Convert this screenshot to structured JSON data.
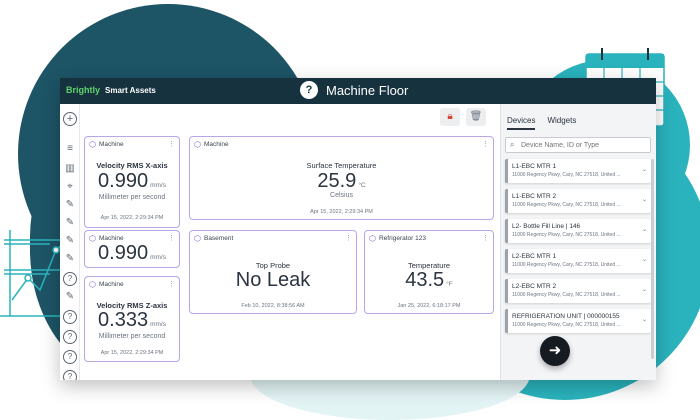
{
  "brand": {
    "logo": "Brightly",
    "product": "Smart Assets"
  },
  "page": {
    "title": "Machine Floor",
    "title_icon": "help-circle-icon"
  },
  "widgets": {
    "w1": {
      "source": "Machine",
      "title": "Velocity RMS X-axis",
      "value": "0.990",
      "unit": "mm/s",
      "subtitle": "Millimeter per second",
      "timestamp": "Apr 15, 2022, 2:29:34 PM"
    },
    "w2": {
      "source": "Machine",
      "title": "Surface Temperature",
      "value": "25.9",
      "unit": "°C",
      "subtitle": "Celsius",
      "timestamp": "Apr 15, 2022, 2:29:34 PM"
    },
    "w3": {
      "source": "Machine",
      "value": "0.990",
      "unit": "mm/s"
    },
    "w4": {
      "source": "Basement",
      "title": "Top Probe",
      "value": "No Leak",
      "timestamp": "Feb 10, 2022, 8:38:56 AM"
    },
    "w5": {
      "source": "Refrigerator 123",
      "title": "Temperature",
      "value": "43.5",
      "unit": "°F",
      "timestamp": "Jan 25, 2022, 6:18:17 PM"
    },
    "w6": {
      "source": "Machine",
      "title": "Velocity RMS Z-axis",
      "value": "0.333",
      "unit": "mm/s",
      "subtitle": "Millimeter per second",
      "timestamp": "Apr 15, 2022, 2:29:34 PM"
    }
  },
  "panel": {
    "tabs": [
      "Devices",
      "Widgets"
    ],
    "search_placeholder": "Device Name, ID or Type",
    "devices": [
      {
        "name": "L1-EBC MTR 1",
        "address": "11000 Regency Pkwy, Cary, NC 27518, United ..."
      },
      {
        "name": "L1-EBC MTR 2",
        "address": "11000 Regency Pkwy, Cary, NC 27518, United ..."
      },
      {
        "name": "L2- Bottle Fill Line | 146",
        "address": "11000 Regency Pkwy, Cary, NC 27518, United ..."
      },
      {
        "name": "L2-EBC MTR 1",
        "address": "11000 Regency Pkwy, Cary, NC 27518, United ..."
      },
      {
        "name": "L2-EBC MTR 2",
        "address": "11000 Regency Pkwy, Cary, NC 27518, United ..."
      },
      {
        "name": "REFRIGERATION UNIT | 000000155",
        "address": "11000 Regency Pkwy, Cary, NC 27518, United ..."
      }
    ]
  },
  "colors": {
    "topbar": "#17323f",
    "widget_border": "#b9a6e6",
    "accent_teal": "#2ab3bd",
    "accent_navy": "#1d5466",
    "lock": "#d9453a"
  },
  "icons": [
    "add-circle-icon",
    "menu-icon",
    "map-icon",
    "location-pin-icon",
    "tools-icon",
    "help-circle-icon",
    "lock-icon",
    "trash-icon",
    "search-icon",
    "chevron-down-icon",
    "arrow-right-icon",
    "cube-icon",
    "kebab-icon",
    "calendar-icon"
  ]
}
